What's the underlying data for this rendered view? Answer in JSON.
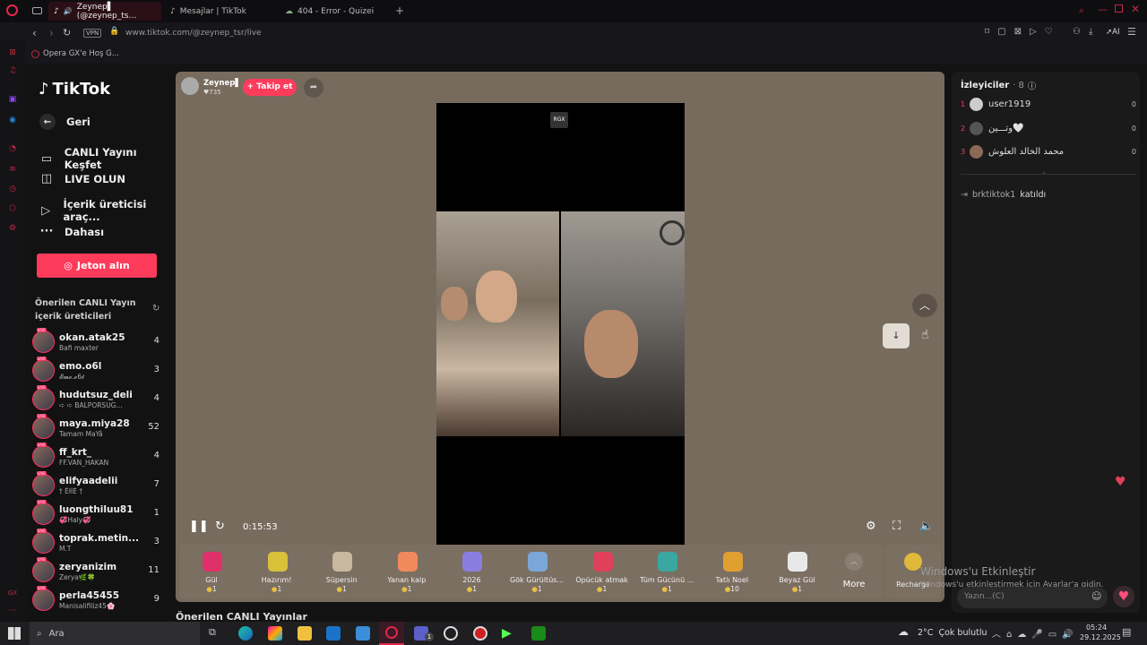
{
  "browser": {
    "tabs": [
      {
        "label": "Zeynep▌ (@zeynep_ts…"
      },
      {
        "label": "Mesajlar | TikTok"
      },
      {
        "label": "404 - Error - Quizei"
      }
    ],
    "vpn": "VPN",
    "url": "www.tiktok.com/@zeynep_tsr/live",
    "ai_label": "AI",
    "bookmark": "Opera GX'e Hoş G..."
  },
  "sidebar": {
    "logo": "TikTok",
    "back": "Geri",
    "items": [
      {
        "label": "CANLI Yayını Keşfet",
        "icon": "tv-icon"
      },
      {
        "label": "LIVE OLUN",
        "icon": "camera-icon"
      },
      {
        "label": "İçerik üreticisi araç...",
        "icon": "creator-tools-icon"
      },
      {
        "label": "Dahası",
        "icon": "more-icon"
      }
    ],
    "jeton": "Jeton alın",
    "creators_title": "Önerilen CANLI Yayın içerik üreticileri",
    "live_badge": "LIVE",
    "creators": [
      {
        "name": "okan.atak25",
        "sub": "Bafi maxter",
        "count": "4"
      },
      {
        "name": "emo.o6l",
        "sub": "𝓔𝓶𝓸.𝓸6𝓵",
        "count": "3"
      },
      {
        "name": "hudutsuz_deli",
        "sub": "➪ ➪ BALPORSUG...",
        "count": "4"
      },
      {
        "name": "maya.miya28",
        "sub": "Tamam MaYâ",
        "count": "52"
      },
      {
        "name": "ff_krt_",
        "sub": "FF.VAN_HAKAN",
        "count": "4"
      },
      {
        "name": "elifyaadelii",
        "sub": "† ËłİÊ †",
        "count": "7"
      },
      {
        "name": "luongthiluu81",
        "sub": "💞Haly💞",
        "count": "1"
      },
      {
        "name": "toprak.metin...",
        "sub": "M.T",
        "count": "3"
      },
      {
        "name": "zeryanizim",
        "sub": "Zerya🌿🍀",
        "count": "11"
      },
      {
        "name": "perla45455",
        "sub": "Manisalifiliz45🌸",
        "count": "9"
      }
    ],
    "bottom_title": "Önerilen CANLI Yayınlar"
  },
  "stream": {
    "host_name": "Zeynep▌",
    "host_likes": "735",
    "follow": "+ Takip et",
    "overlay_tag": "RGX",
    "time": "0:15:53"
  },
  "gifts": [
    {
      "name": "Gül",
      "price": "1",
      "color": "#e0306a"
    },
    {
      "name": "Hazırım!",
      "price": "1",
      "color": "#d9c13a"
    },
    {
      "name": "Süpersin",
      "price": "1",
      "color": "#c9b8a0"
    },
    {
      "name": "Yanan kalp",
      "price": "1",
      "color": "#f08a5d"
    },
    {
      "name": "2026",
      "price": "1",
      "color": "#8a7de0"
    },
    {
      "name": "Gök Gürültüs...",
      "price": "1",
      "color": "#7aa7d8"
    },
    {
      "name": "Öpücük atmak",
      "price": "1",
      "color": "#e0405a"
    },
    {
      "name": "Tüm Gücünü ...",
      "price": "1",
      "color": "#3aa7a0"
    },
    {
      "name": "Tatlı Noel",
      "price": "10",
      "color": "#e0a030"
    },
    {
      "name": "Beyaz Gül",
      "price": "1",
      "color": "#e8e8e8"
    }
  ],
  "more_label": "More",
  "recharge": "Recharge",
  "viewers": {
    "title": "İzleyiciler",
    "count": "· 8",
    "list": [
      {
        "rank": "1",
        "name": "user1919",
        "num": "0"
      },
      {
        "rank": "2",
        "name": "وتـــين🤍",
        "num": "0"
      },
      {
        "rank": "3",
        "name": "محمد الخالد العلوش",
        "num": "0"
      }
    ],
    "join_user": "brktiktok1",
    "join_text": "katıldı"
  },
  "chat_placeholder": "Yazın...(C)",
  "watermark": {
    "title": "Windows'u Etkinleştir",
    "sub": "Windows'u etkinleştirmek için Ayarlar'a gidin."
  },
  "taskbar": {
    "search": "Ara",
    "weather": "2°C  Çok bulutlu",
    "time": "05:24",
    "date": "29.12.2025",
    "badge": "1"
  }
}
